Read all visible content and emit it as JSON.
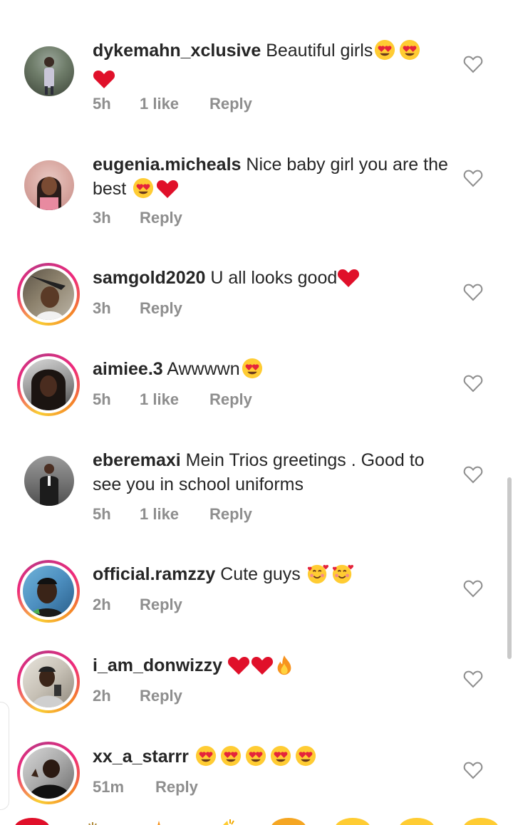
{
  "comments": [
    {
      "username": "dykemahn_xclusive",
      "text": "Beautiful girls",
      "emojis": [
        "heart-eyes",
        "heart-eyes",
        "red-heart"
      ],
      "time": "5h",
      "likes": "1 like",
      "reply": "Reply"
    },
    {
      "username": "eugenia.micheals",
      "text": "Nice baby girl you are the best",
      "emojis": [
        "heart-eyes",
        "red-heart"
      ],
      "time": "3h",
      "likes": "",
      "reply": "Reply"
    },
    {
      "username": "samgold2020",
      "text": "U all looks good",
      "emojis": [
        "red-heart"
      ],
      "time": "3h",
      "likes": "",
      "reply": "Reply"
    },
    {
      "username": "aimiee.3",
      "text": "Awwwwn",
      "emojis": [
        "heart-eyes"
      ],
      "time": "5h",
      "likes": "1 like",
      "reply": "Reply"
    },
    {
      "username": "eberemaxi",
      "text": "Mein Trios greetings . Good to see you in school  uniforms",
      "emojis": [],
      "time": "5h",
      "likes": "1 like",
      "reply": "Reply"
    },
    {
      "username": "official.ramzzy",
      "text": "Cute guys",
      "emojis": [
        "smiling-hearts",
        "smiling-hearts"
      ],
      "time": "2h",
      "likes": "",
      "reply": "Reply"
    },
    {
      "username": "i_am_donwizzy",
      "text": "",
      "emojis": [
        "red-heart",
        "red-heart",
        "fire"
      ],
      "time": "2h",
      "likes": "",
      "reply": "Reply"
    },
    {
      "username": "xx_a_starrr",
      "text": "",
      "emojis": [
        "heart-eyes",
        "heart-eyes",
        "heart-eyes",
        "heart-eyes",
        "heart-eyes"
      ],
      "time": "51m",
      "likes": "",
      "reply": "Reply"
    }
  ],
  "icons": {
    "like": "heart-outline-icon"
  },
  "colors": {
    "meta": "#8e8e8e",
    "text": "#262626",
    "heart": "#e0102a"
  }
}
